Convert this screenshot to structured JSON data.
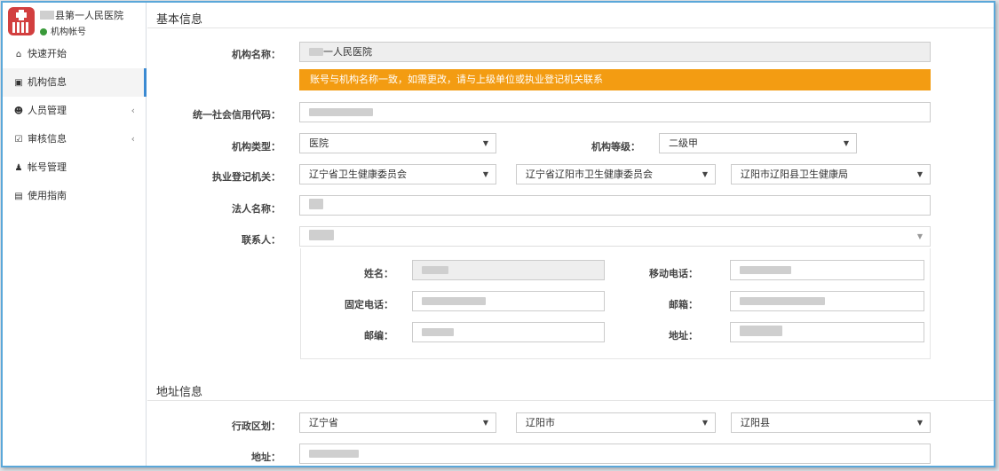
{
  "sidebar": {
    "org_name": "县第一人民医院",
    "account_type": "机构帐号",
    "items": [
      {
        "label": "快速开始",
        "icon": "home-icon",
        "glyph": "⌂"
      },
      {
        "label": "机构信息",
        "icon": "building-icon",
        "glyph": "▣"
      },
      {
        "label": "人员管理",
        "icon": "users-icon",
        "glyph": "☻",
        "chevron": "‹"
      },
      {
        "label": "审核信息",
        "icon": "edit-check-icon",
        "glyph": "☑",
        "chevron": "‹"
      },
      {
        "label": "帐号管理",
        "icon": "user-icon",
        "glyph": "♟"
      },
      {
        "label": "使用指南",
        "icon": "book-icon",
        "glyph": "▤"
      }
    ]
  },
  "basic": {
    "title": "基本信息",
    "org_name_label": "机构名称：",
    "org_name_value": "一人民医院",
    "warning": "账号与机构名称一致，如需更改，请与上级单位或执业登记机关联系",
    "credit_code_label": "统一社会信用代码：",
    "type_label": "机构类型：",
    "type_value": "医院",
    "level_label": "机构等级：",
    "level_value": "二级甲",
    "registrar_label": "执业登记机关：",
    "registrar_province": "辽宁省卫生健康委员会",
    "registrar_city": "辽宁省辽阳市卫生健康委员会",
    "registrar_county": "辽阳市辽阳县卫生健康局",
    "legal_label": "法人名称：",
    "contact_label": "联系人：",
    "contact": {
      "name_label": "姓名：",
      "mobile_label": "移动电话：",
      "phone_label": "固定电话：",
      "email_label": "邮箱：",
      "zip_label": "邮编：",
      "addr_label": "地址："
    }
  },
  "address": {
    "title": "地址信息",
    "region_label": "行政区划：",
    "province": "辽宁省",
    "city": "辽阳市",
    "county": "辽阳县",
    "addr_label": "地址："
  },
  "colors": {
    "accent": "#3b8ad2",
    "warning": "#f39c12",
    "logo": "#d23f3f",
    "online": "#3a9a3a"
  }
}
